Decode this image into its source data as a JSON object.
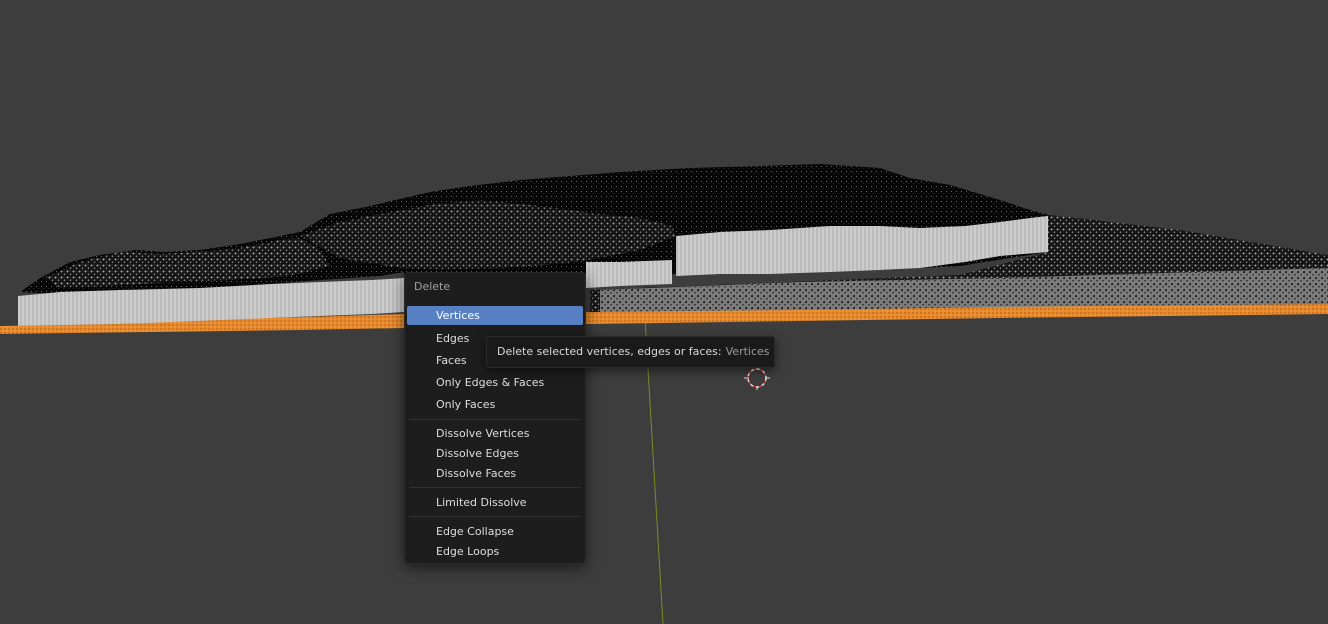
{
  "menu": {
    "title": "Delete",
    "items": [
      {
        "label": "Vertices",
        "active": true
      },
      {
        "label": "Edges"
      },
      {
        "label": "Faces"
      },
      {
        "label": "Only Edges & Faces"
      },
      {
        "label": "Only Faces"
      },
      {
        "label": "Dissolve Vertices"
      },
      {
        "label": "Dissolve Edges"
      },
      {
        "label": "Dissolve Faces"
      },
      {
        "label": "Limited Dissolve"
      },
      {
        "label": "Edge Collapse"
      },
      {
        "label": "Edge Loops"
      }
    ]
  },
  "tooltip": {
    "text": "Delete selected vertices, edges or faces:",
    "value": "Vertices"
  },
  "colors": {
    "background": "#3d3d3d",
    "menu_bg": "#1d1d1d",
    "highlight": "#5680c2",
    "selection_orange": "#e8892c",
    "wire_grey": "#cfcfcf",
    "mesh_black": "#0a0a0a",
    "axis_green": "#7d8a2a"
  },
  "icons": {
    "cursor": "3d-cursor-icon"
  }
}
